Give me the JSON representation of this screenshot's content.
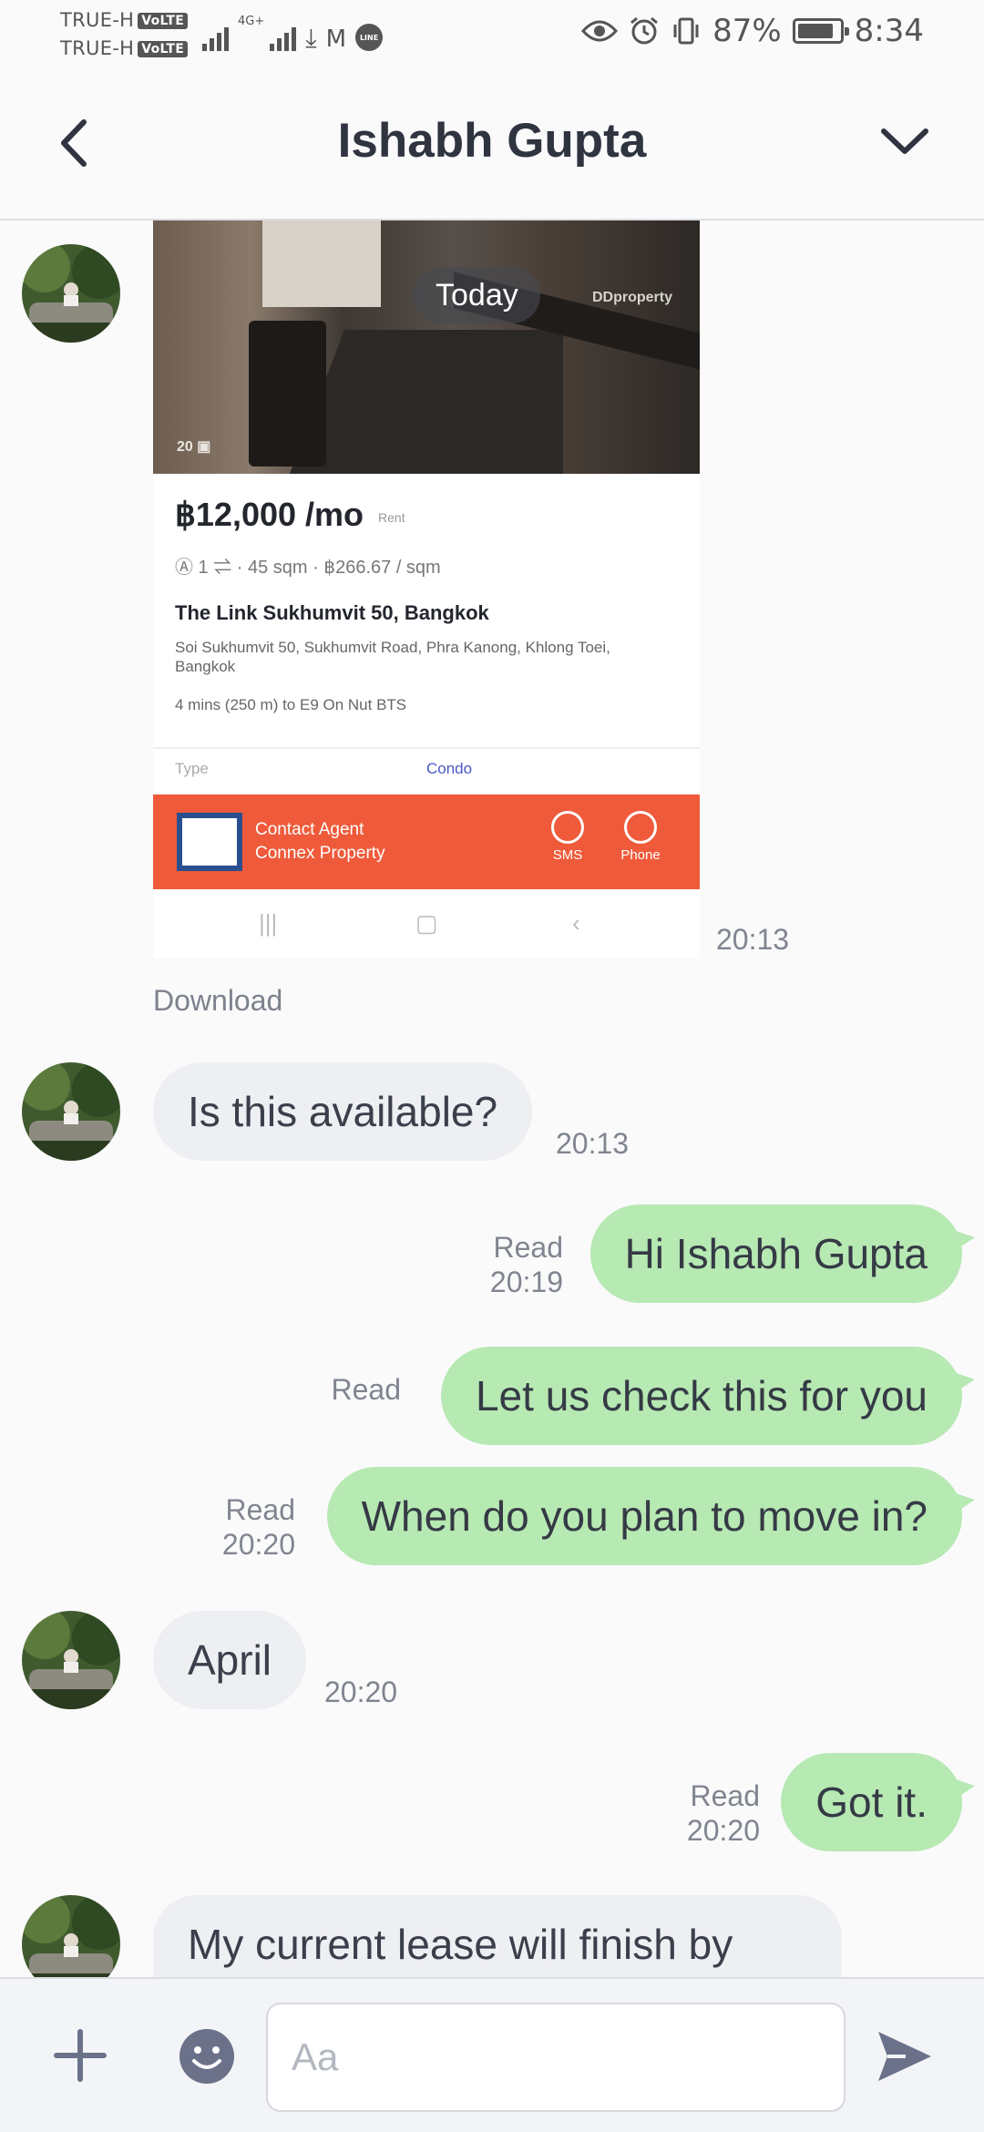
{
  "status_bar": {
    "carrier1": "TRUE-H",
    "carrier2": "TRUE-H",
    "volte": "VoLTE",
    "network": "4G+",
    "battery": "87%",
    "battery_level": 0.87,
    "time": "8:34"
  },
  "header": {
    "title": "Ishabh Gupta"
  },
  "shared_image": {
    "date_pill": "Today",
    "price": "฿12,000 /mo",
    "rent_tag": "Rent",
    "specs": "Ⓐ 1 ⇌ · 45 sqm · ฿266.67 / sqm",
    "property_name": "The Link Sukhumvit 50, Bangkok",
    "address": "Soi Sukhumvit 50, Sukhumvit Road, Phra Kanong, Khlong Toei, Bangkok",
    "transit": "4 mins (250 m) to E9 On Nut BTS",
    "type_label": "Type",
    "type_value": "Condo",
    "agent_line1": "Contact Agent",
    "agent_line2": "Connex Property",
    "sms_label": "SMS",
    "phone_label": "Phone",
    "photo_count": "20 ▣",
    "watermark": "DDproperty",
    "time": "20:13",
    "download_label": "Download"
  },
  "messages": [
    {
      "direction": "in",
      "text": "Is this available?",
      "time": "20:13",
      "read": ""
    },
    {
      "direction": "out",
      "text": "Hi Ishabh Gupta",
      "time": "20:19",
      "read": "Read"
    },
    {
      "direction": "out",
      "text": "Let us check this for you",
      "time": "",
      "read": "Read"
    },
    {
      "direction": "out",
      "text": "When do you plan to move in?",
      "time": "20:20",
      "read": "Read"
    },
    {
      "direction": "in",
      "text": "April",
      "time": "20:20",
      "read": ""
    },
    {
      "direction": "out",
      "text": "Got it.",
      "time": "20:20",
      "read": "Read"
    },
    {
      "direction": "in",
      "text": "My current lease will finish by",
      "time": "",
      "read": ""
    }
  ],
  "composer": {
    "placeholder": "Aa"
  },
  "colors": {
    "outgoing_bubble": "#b7e9b3",
    "incoming_bubble": "#eeeff2",
    "icon_gray": "#6b7189"
  },
  "icons": [
    "back-arrow-icon",
    "chevron-down-icon",
    "plus-icon",
    "emoji-icon",
    "send-icon",
    "eye-icon",
    "alarm-icon",
    "vibrate-icon",
    "battery-icon",
    "download-icon",
    "gmail-icon",
    "line-icon"
  ]
}
